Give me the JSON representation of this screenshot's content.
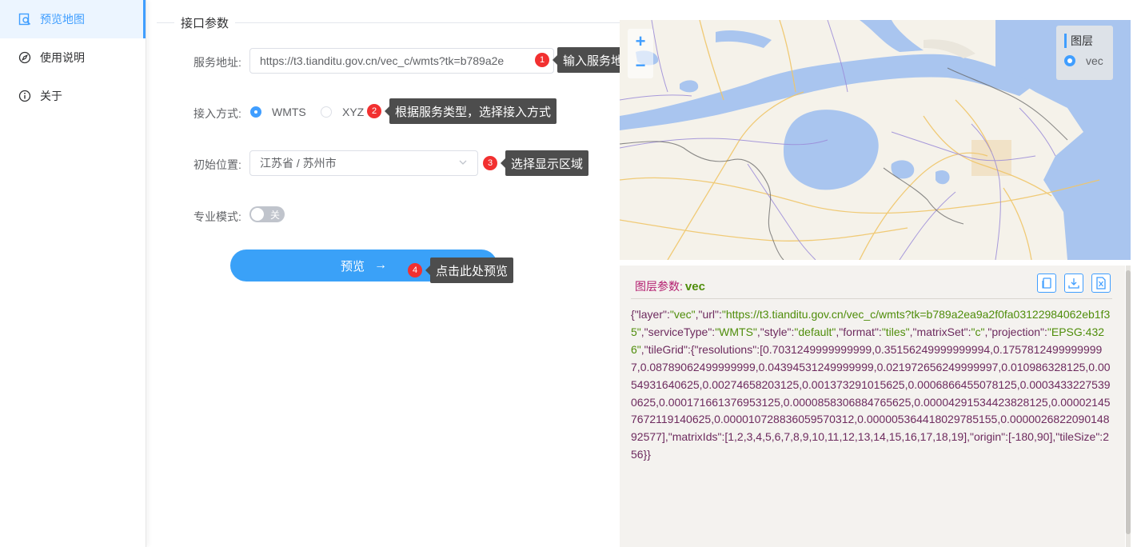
{
  "sidebar": {
    "items": [
      {
        "label": "预览地图",
        "icon": "map-search-icon",
        "active": true
      },
      {
        "label": "使用说明",
        "icon": "compass-icon",
        "active": false
      },
      {
        "label": "关于",
        "icon": "info-icon",
        "active": false
      }
    ]
  },
  "form": {
    "section_title": "接口参数",
    "service_url_label": "服务地址:",
    "service_url_value": "https://t3.tianditu.gov.cn/vec_c/wmts?tk=b789a2e",
    "access_mode_label": "接入方式:",
    "access_options": [
      {
        "label": "WMTS",
        "checked": true
      },
      {
        "label": "XYZ",
        "checked": false
      }
    ],
    "initial_location_label": "初始位置:",
    "initial_location_value": "江苏省 / 苏州市",
    "pro_mode_label": "专业模式:",
    "pro_mode_switch_text": "关",
    "pro_mode_on": false,
    "preview_button": "预览"
  },
  "annotations": [
    {
      "num": "1",
      "text": "输入服务地址"
    },
    {
      "num": "2",
      "text": "根据服务类型，选择接入方式"
    },
    {
      "num": "3",
      "text": "选择显示区域"
    },
    {
      "num": "4",
      "text": "点击此处预览"
    }
  ],
  "map": {
    "zoom_in": "+",
    "zoom_out": "−",
    "layers_title": "图层",
    "layer_option": "vec"
  },
  "params_panel": {
    "title": "图层参数:",
    "layer_name": "vec",
    "tool_icons": [
      "copy-icon",
      "download-icon",
      "export-file-icon"
    ],
    "json_text": "{\"layer\":\"vec\",\"url\":\"https://t3.tianditu.gov.cn/vec_c/wmts?tk=b789a2ea9a2f0fa03122984062eb1f35\",\"serviceType\":\"WMTS\",\"style\":\"default\",\"format\":\"tiles\",\"matrixSet\":\"c\",\"projection\":\"EPSG:4326\",\"tileGrid\":{\"resolutions\":[0.7031249999999999,0.35156249999999994,0.17578124999999997,0.08789062499999999,0.04394531249999999,0.021972656249999997,0.010986328125,0.0054931640625,0.00274658203125,0.001373291015625,0.0006866455078125,0.00034332275390625,0.000171661376953125,0.0000858306884765625,0.00004291534423828125,0.000021457672119140625,0.000010728836059570312,0.000005364418029785155,0.000002682209014892577],\"matrixIds\":[1,2,3,4,5,6,7,8,9,10,11,12,13,14,15,16,17,18,19],\"origin\":[-180,90],\"tileSize\":256}}"
  },
  "colors": {
    "accent": "#409eff",
    "button": "#3aa1f8",
    "badge": "#f23030",
    "tooltip": "#4d4d4d",
    "water": "#a9c5ef",
    "land": "#f5f2ea"
  }
}
